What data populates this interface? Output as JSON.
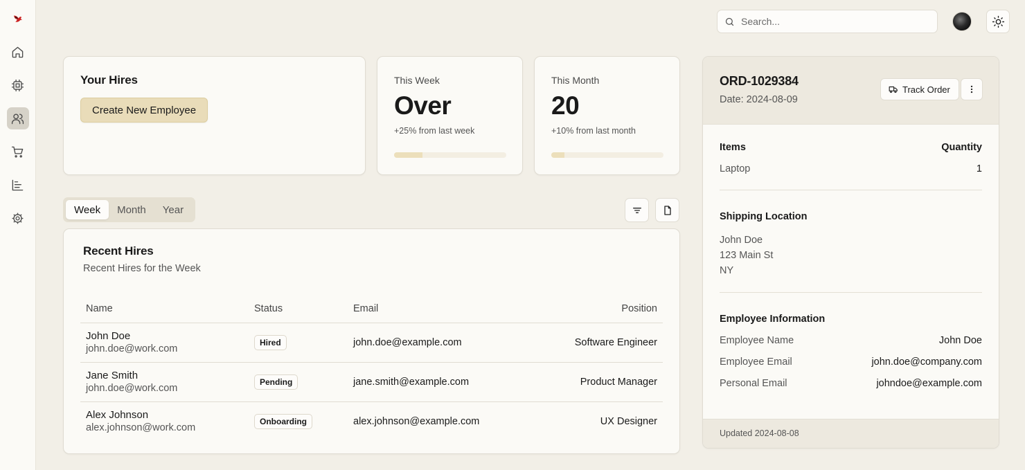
{
  "search": {
    "placeholder": "Search..."
  },
  "sidebar": {
    "items": [
      {
        "icon": "home-icon"
      },
      {
        "icon": "chip-icon"
      },
      {
        "icon": "users-icon",
        "active": true
      },
      {
        "icon": "cart-icon"
      },
      {
        "icon": "chart-icon"
      },
      {
        "icon": "settings-icon"
      }
    ]
  },
  "hires": {
    "title": "Your Hires",
    "create_label": "Create New Employee"
  },
  "stats": {
    "week": {
      "label": "This Week",
      "value": "Over",
      "sub": "+25% from last week",
      "progress": 0.25
    },
    "month": {
      "label": "This Month",
      "value": "20",
      "sub": "+10% from last month",
      "progress": 0.12
    }
  },
  "tabs": [
    "Week",
    "Month",
    "Year"
  ],
  "recent": {
    "title": "Recent Hires",
    "description": "Recent Hires for the Week",
    "columns": [
      "Name",
      "Status",
      "Email",
      "Position"
    ],
    "rows": [
      {
        "name": "John Doe",
        "work_email": "john.doe@work.com",
        "status": "Hired",
        "email": "john.doe@example.com",
        "position": "Software Engineer"
      },
      {
        "name": "Jane Smith",
        "work_email": "john.doe@work.com",
        "status": "Pending",
        "email": "jane.smith@example.com",
        "position": "Product Manager"
      },
      {
        "name": "Alex Johnson",
        "work_email": "alex.johnson@work.com",
        "status": "Onboarding",
        "email": "alex.johnson@example.com",
        "position": "UX Designer"
      }
    ]
  },
  "order": {
    "id": "ORD-1029384",
    "date": "Date: 2024-08-09",
    "track_label": "Track Order",
    "items_header": "Items",
    "quantity_header": "Quantity",
    "items": [
      {
        "name": "Laptop",
        "qty": "1"
      }
    ],
    "shipping_title": "Shipping Location",
    "shipping_lines": [
      "John Doe",
      "123 Main St",
      "NY"
    ],
    "employee_title": "Employee Information",
    "employee_fields": [
      {
        "label": "Employee Name",
        "value": "John Doe"
      },
      {
        "label": "Employee Email",
        "value": "john.doe@company.com"
      },
      {
        "label": "Personal Email",
        "value": "johndoe@example.com"
      }
    ],
    "updated": "Updated 2024-08-08"
  },
  "colors": {
    "accent": "#e9dcb9",
    "background": "#f2efe7",
    "panel_header": "#ede9df"
  }
}
